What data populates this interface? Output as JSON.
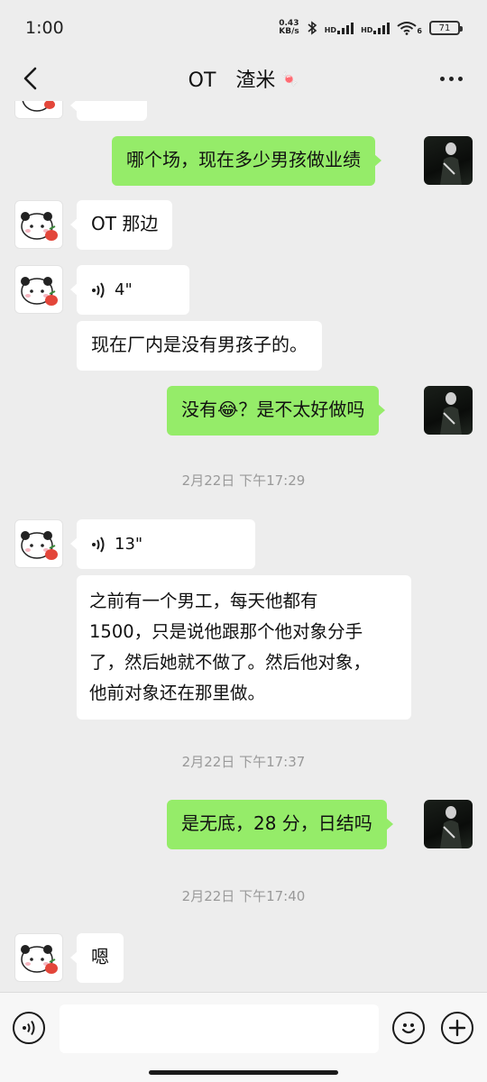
{
  "status_bar": {
    "time": "1:00",
    "net_speed_value": "0.43",
    "net_speed_unit": "KB/s",
    "bt_icon": "bluetooth-icon",
    "hd1": "HD",
    "hd2": "HD",
    "wifi_sub": "6",
    "battery": "71"
  },
  "header": {
    "title": "OT　渣米",
    "title_emoji": "🍬",
    "back_icon": "chevron-left-icon",
    "more_icon": "more-icon"
  },
  "messages": [
    {
      "side": "left",
      "type": "text",
      "text": "哪个场，现在多少男孩做业绩"
    },
    {
      "side": "left",
      "type": "text",
      "text": "OT 那边"
    },
    {
      "side": "left",
      "type": "voice",
      "duration": "4\""
    },
    {
      "side": "left",
      "type": "text",
      "text": "现在厂内是没有男孩子的。"
    },
    {
      "side": "right",
      "type": "text",
      "text": "没有",
      "emoji": "😂",
      "text_after": "？是不太好做吗"
    },
    {
      "type": "time",
      "text": "2月22日 下午17:29"
    },
    {
      "side": "left",
      "type": "voice",
      "duration": "13\""
    },
    {
      "side": "left",
      "type": "text",
      "lines": [
        "之前有一个男工，每天他都有",
        "1500，只是说他跟那个他对象分手",
        "了，然后她就不做了。然后他对象，",
        "他前对象还在那里做。"
      ]
    },
    {
      "type": "time",
      "text": "2月22日 下午17:37"
    },
    {
      "side": "right",
      "type": "text",
      "text": "是无底，28 分，日结吗"
    },
    {
      "type": "time",
      "text": "2月22日 下午17:40"
    },
    {
      "side": "left",
      "type": "text",
      "text": "嗯"
    }
  ],
  "input_bar": {
    "voice_icon": "voice-input-icon",
    "emoji_icon": "emoji-icon",
    "plus_icon": "plus-icon",
    "placeholder": ""
  }
}
